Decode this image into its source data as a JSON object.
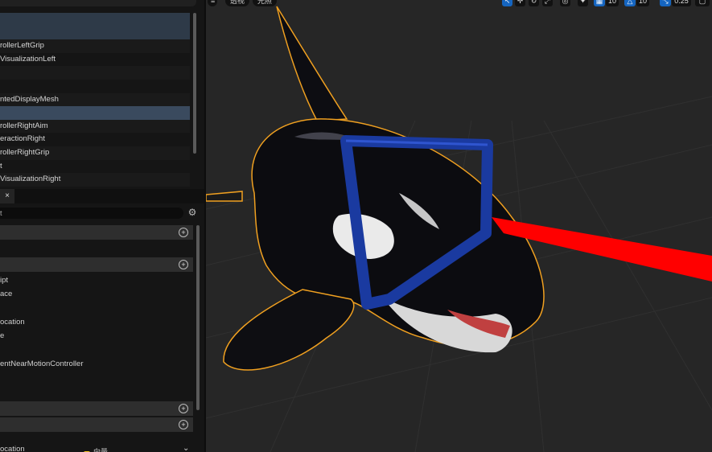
{
  "outliner": {
    "rows": [
      "",
      "",
      "rollerLeftGrip",
      "VisualizationLeft",
      "",
      "",
      "ntedDisplayMesh",
      "",
      "rollerRightAim",
      "eractionRight",
      "rollerRightGrip",
      "t",
      "VisualizationRight"
    ]
  },
  "tab": {
    "close_label": "×"
  },
  "details": {
    "search_value": "t",
    "items": [
      "ipt",
      "ace",
      "ocation",
      "e",
      "entNearMotionController"
    ],
    "bottom_label": "ocation",
    "bottom_type": "向量"
  },
  "viewport": {
    "perspective_label": "透视",
    "lit_label": "光照",
    "grid_value": "10",
    "rotation_value": "10",
    "scale_value": "0.25"
  },
  "colors": {
    "accent": "#1565c0",
    "selection": "#f0a020",
    "laser": "#ff0000"
  }
}
